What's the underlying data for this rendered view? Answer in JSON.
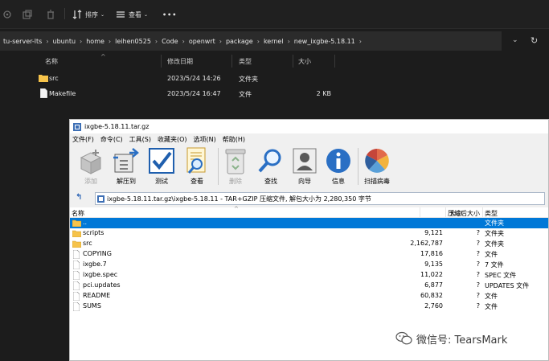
{
  "explorer": {
    "toolbar": {
      "sort_label": "排序",
      "view_label": "查看",
      "more_label": "•••"
    },
    "breadcrumb": [
      "tu-server-lts",
      "ubuntu",
      "home",
      "leihen0525",
      "Code",
      "openwrt",
      "package",
      "kernel",
      "new_ixgbe-5.18.11"
    ],
    "columns": {
      "name": "名称",
      "modified": "修改日期",
      "type": "类型",
      "size": "大小"
    },
    "files": [
      {
        "name": "src",
        "modified": "2023/5/24 14:26",
        "type": "文件夹",
        "size": "",
        "icon": "folder-icon"
      },
      {
        "name": "Makefile",
        "modified": "2023/5/24 16:47",
        "type": "文件",
        "size": "2 KB",
        "icon": "file-icon"
      }
    ]
  },
  "zip": {
    "title": "ixgbe-5.18.11.tar.gz",
    "menu": [
      "文件(F)",
      "命令(C)",
      "工具(S)",
      "收藏夹(O)",
      "选项(N)",
      "帮助(H)"
    ],
    "tools": [
      {
        "label": "添加",
        "icon": "add-icon",
        "enabled": false
      },
      {
        "label": "解压到",
        "icon": "extract-icon",
        "enabled": true
      },
      {
        "label": "测试",
        "icon": "test-icon",
        "enabled": true
      },
      {
        "label": "查看",
        "icon": "view-icon",
        "enabled": true
      },
      {
        "label": "删除",
        "icon": "delete-icon",
        "enabled": false
      },
      {
        "label": "查找",
        "icon": "find-icon",
        "enabled": true
      },
      {
        "label": "向导",
        "icon": "wizard-icon",
        "enabled": true
      },
      {
        "label": "信息",
        "icon": "info-icon",
        "enabled": true
      },
      {
        "label": "扫描病毒",
        "icon": "virus-scan-icon",
        "enabled": true
      }
    ],
    "address": "ixgbe-5.18.11.tar.gz\\ixgbe-5.18.11 - TAR+GZIP 压缩文件, 解包大小为 2,280,350 字节",
    "columns": {
      "name": "名称",
      "size": "大小",
      "packed": "压缩后大小",
      "type": "类型"
    },
    "rows": [
      {
        "name": "..",
        "size": "",
        "packed": "",
        "type": "文件夹",
        "icon": "folder-icon",
        "selected": true
      },
      {
        "name": "scripts",
        "size": "9,121",
        "packed": "?",
        "type": "文件夹",
        "icon": "folder-icon",
        "selected": false
      },
      {
        "name": "src",
        "size": "2,162,787",
        "packed": "?",
        "type": "文件夹",
        "icon": "folder-icon",
        "selected": false
      },
      {
        "name": "COPYING",
        "size": "17,816",
        "packed": "?",
        "type": "文件",
        "icon": "file-icon",
        "selected": false
      },
      {
        "name": "ixgbe.7",
        "size": "9,135",
        "packed": "?",
        "type": "7 文件",
        "icon": "file-icon",
        "selected": false
      },
      {
        "name": "ixgbe.spec",
        "size": "11,022",
        "packed": "?",
        "type": "SPEC 文件",
        "icon": "file-icon",
        "selected": false
      },
      {
        "name": "pci.updates",
        "size": "6,877",
        "packed": "?",
        "type": "UPDATES 文件",
        "icon": "file-icon",
        "selected": false
      },
      {
        "name": "README",
        "size": "60,832",
        "packed": "?",
        "type": "文件",
        "icon": "file-icon",
        "selected": false
      },
      {
        "name": "SUMS",
        "size": "2,760",
        "packed": "?",
        "type": "文件",
        "icon": "file-icon",
        "selected": false
      }
    ]
  },
  "watermark": {
    "text": "微信号: TearsMark"
  },
  "colors": {
    "selection": "#0078d7",
    "folder": "#f6c34a",
    "explorer_bg": "#1c1c1c"
  }
}
